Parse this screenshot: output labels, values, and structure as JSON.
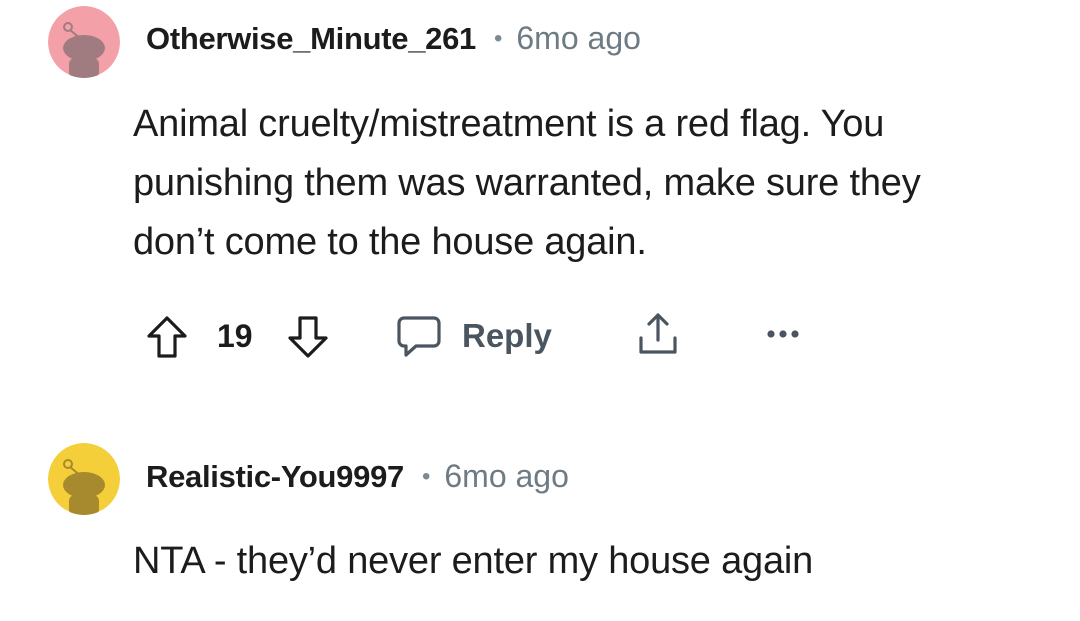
{
  "comments": [
    {
      "username": "Otherwise_Minute_261",
      "separator": "•",
      "time": "6mo ago",
      "avatar_color": "#f4a0a8",
      "avatar_figure_color": "#a07c80",
      "body_lines": [
        "Animal cruelty/mistreatment is a red flag. You",
        "punishing them was warranted, make sure they",
        "don’t come to the house again."
      ],
      "actions": {
        "upvote_icon": "arrow-up-icon",
        "score": "19",
        "downvote_icon": "arrow-down-icon",
        "reply_icon": "speech-bubble-icon",
        "reply_label": "Reply",
        "share_icon": "share-icon",
        "more_icon": "more-options-icon"
      }
    },
    {
      "username": "Realistic-You9997",
      "separator": "•",
      "time": "6mo ago",
      "avatar_color": "#f5cf3a",
      "avatar_figure_color": "#a78a2e",
      "body_lines": [
        "NTA - they’d never enter my house again"
      ]
    }
  ]
}
